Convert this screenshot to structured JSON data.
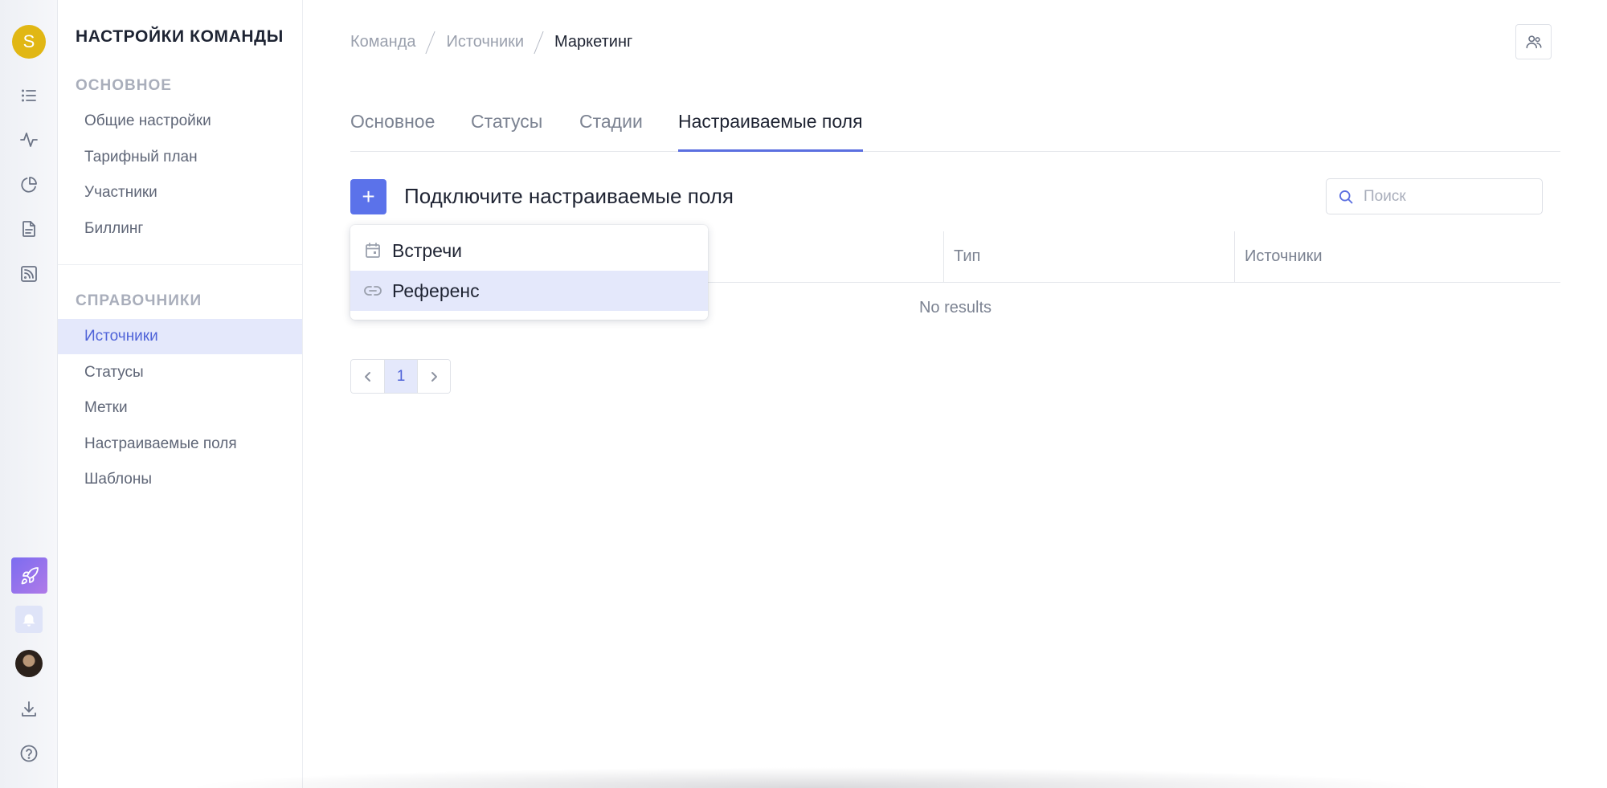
{
  "rail": {
    "team_initial": "S"
  },
  "sidebar": {
    "title": "НАСТРОЙКИ КОМАНДЫ",
    "section_main": "ОСНОВНОЕ",
    "main_items": [
      {
        "label": "Общие настройки"
      },
      {
        "label": "Тарифный план"
      },
      {
        "label": "Участники"
      },
      {
        "label": "Биллинг"
      }
    ],
    "section_refs": "СПРАВОЧНИКИ",
    "ref_items": [
      {
        "label": "Источники",
        "active": true
      },
      {
        "label": "Статусы"
      },
      {
        "label": "Метки"
      },
      {
        "label": "Настраиваемые поля"
      },
      {
        "label": "Шаблоны"
      }
    ]
  },
  "breadcrumb": [
    "Команда",
    "Источники",
    "Маркетинг"
  ],
  "tabs": [
    {
      "label": "Основное"
    },
    {
      "label": "Статусы"
    },
    {
      "label": "Стадии"
    },
    {
      "label": "Настраиваемые поля",
      "active": true
    }
  ],
  "toolbar": {
    "add_label": "+",
    "heading": "Подключите настраиваемые поля",
    "search_placeholder": "Поиск"
  },
  "table": {
    "columns": [
      "",
      "Тип",
      "Источники"
    ],
    "empty_text": "No results"
  },
  "pagination": {
    "current_page": "1"
  },
  "dropdown": {
    "items": [
      {
        "label": "Встречи",
        "icon": "calendar-icon"
      },
      {
        "label": "Референс",
        "icon": "link-icon",
        "highlighted": true
      }
    ]
  },
  "colors": {
    "accent": "#5b72ea",
    "active_bg": "#e4e8fb",
    "team_avatar": "#e1b714"
  }
}
